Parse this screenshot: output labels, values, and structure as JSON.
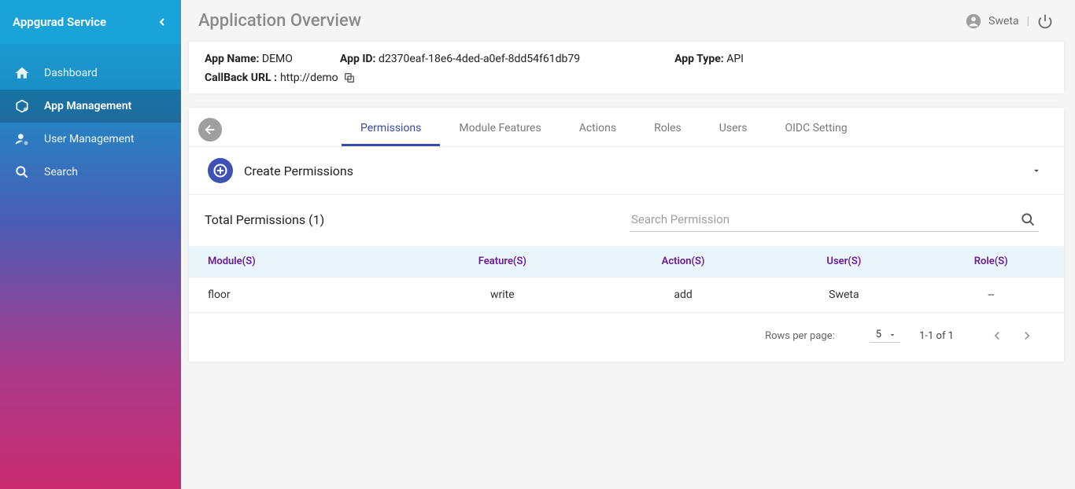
{
  "sidebar": {
    "title": "Appgurad Service",
    "items": [
      {
        "label": "Dashboard"
      },
      {
        "label": "App Management"
      },
      {
        "label": "User Management"
      },
      {
        "label": "Search"
      }
    ]
  },
  "header": {
    "page_title": "Application Overview",
    "username": "Sweta"
  },
  "app_info": {
    "name_label": "App Name:",
    "name_value": "DEMO",
    "id_label": "App ID:",
    "id_value": "d2370eaf-18e6-4ded-a0ef-8dd54f61db79",
    "type_label": "App Type:",
    "type_value": "API",
    "callback_label": "CallBack URL :",
    "callback_value": "http://demo"
  },
  "tabs": [
    "Permissions",
    "Module Features",
    "Actions",
    "Roles",
    "Users",
    "OIDC Setting"
  ],
  "create": {
    "label": "Create Permissions"
  },
  "permissions": {
    "total_label": "Total Permissions (1)",
    "search_placeholder": "Search Permission",
    "columns": {
      "module": "Module(S)",
      "feature": "Feature(S)",
      "action": "Action(S)",
      "user": "User(S)",
      "role": "Role(S)"
    },
    "rows": [
      {
        "module": "floor",
        "feature": "write",
        "action": "add",
        "user": "Sweta",
        "role": "--"
      }
    ]
  },
  "pagination": {
    "rows_per_page_label": "Rows per page:",
    "rows_per_page_value": "5",
    "range": "1-1 of 1"
  }
}
